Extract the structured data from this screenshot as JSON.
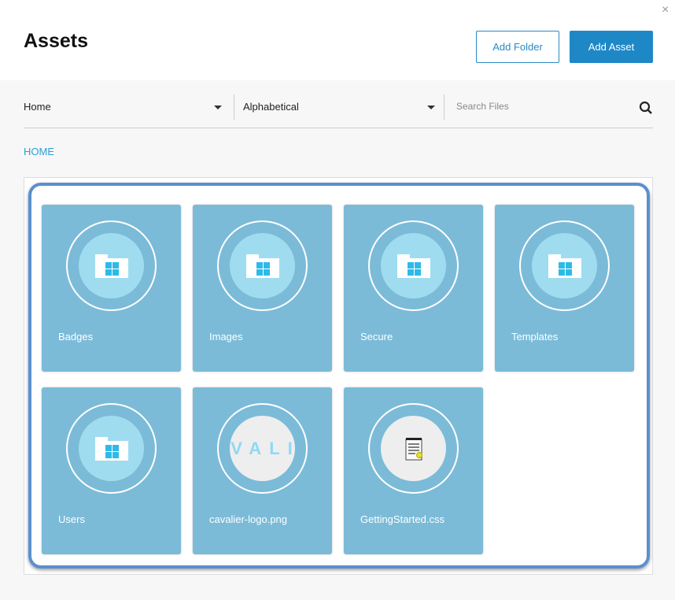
{
  "header": {
    "title": "Assets",
    "add_folder": "Add Folder",
    "add_asset": "Add Asset",
    "close": "×"
  },
  "toolbar": {
    "folder_select": "Home",
    "sort_select": "Alphabetical",
    "search_placeholder": "Search Files"
  },
  "breadcrumb": "HOME",
  "items": [
    {
      "name": "Badges",
      "type": "folder"
    },
    {
      "name": "Images",
      "type": "folder"
    },
    {
      "name": "Secure",
      "type": "folder"
    },
    {
      "name": "Templates",
      "type": "folder"
    },
    {
      "name": "Users",
      "type": "folder"
    },
    {
      "name": "cavalier-logo.png",
      "type": "image",
      "preview_text": "VALI"
    },
    {
      "name": "GettingStarted.css",
      "type": "file"
    }
  ]
}
